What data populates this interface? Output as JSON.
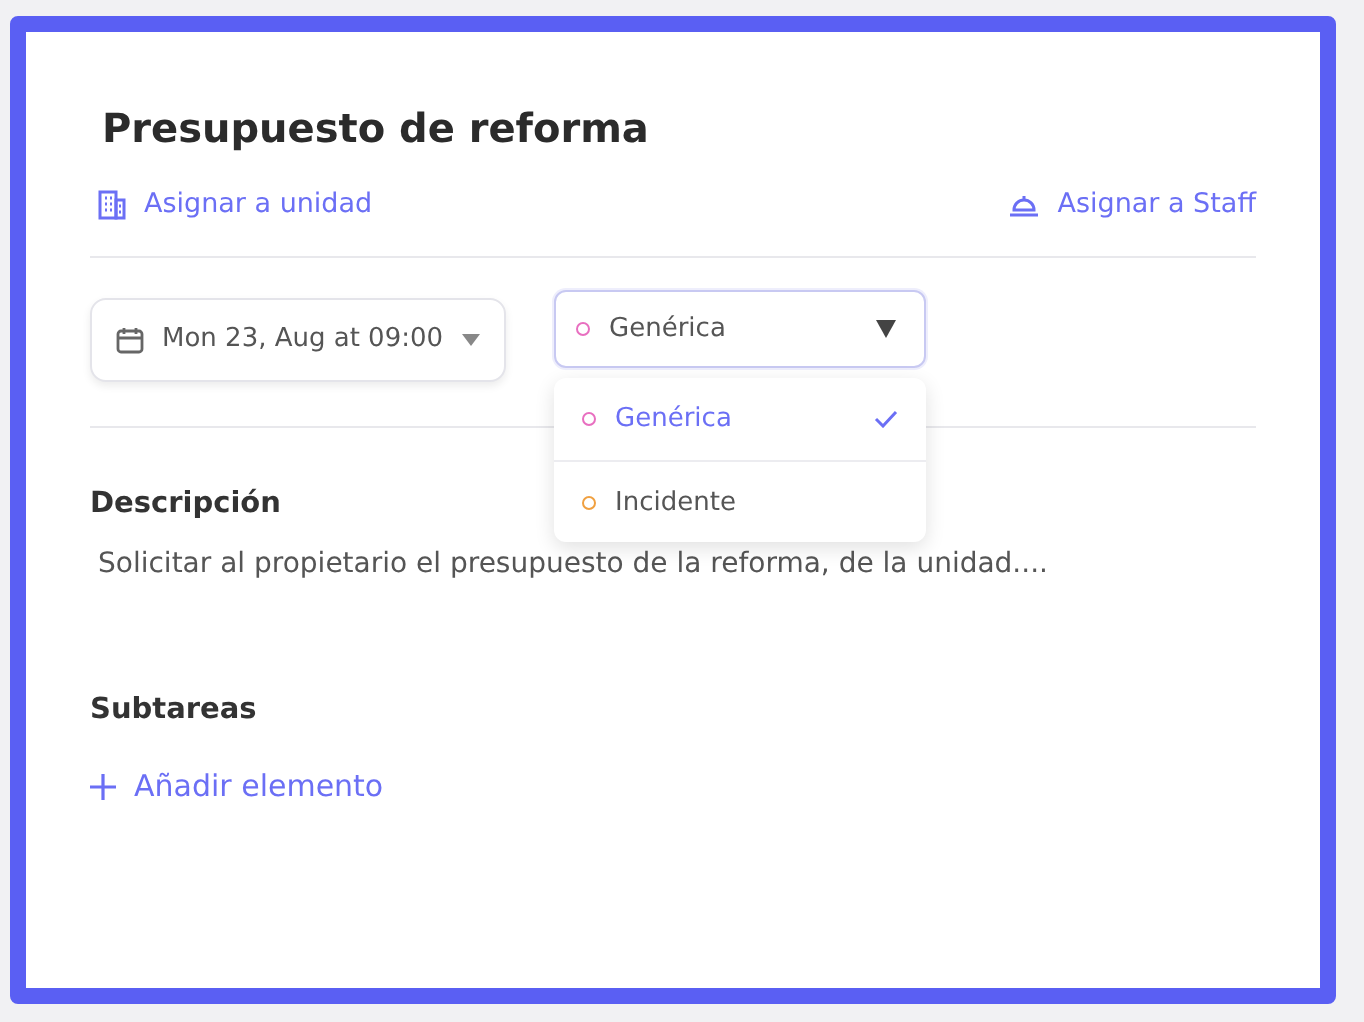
{
  "title": "Presupuesto de reforma",
  "actions": [
    {
      "label": "Asignar a unidad",
      "kind": "unit"
    },
    {
      "label": "Asignar a Staff",
      "kind": "staff"
    }
  ],
  "date": {
    "value": "Mon 23, Aug at 09:00"
  },
  "type_select": {
    "value": "Genérica",
    "color": "#e86fc0",
    "expanded": true,
    "options": [
      {
        "label": "Genérica",
        "color": "#e86fc0",
        "selected": true
      },
      {
        "label": "Incidente",
        "color": "#f0a040",
        "selected": false
      }
    ]
  },
  "description": {
    "heading": "Descripción",
    "text": "Solicitar al propietario el presupuesto de la reforma, de la unidad...."
  },
  "subtasks": {
    "heading": "Subtareas",
    "add_label": "Añadir elemento"
  }
}
